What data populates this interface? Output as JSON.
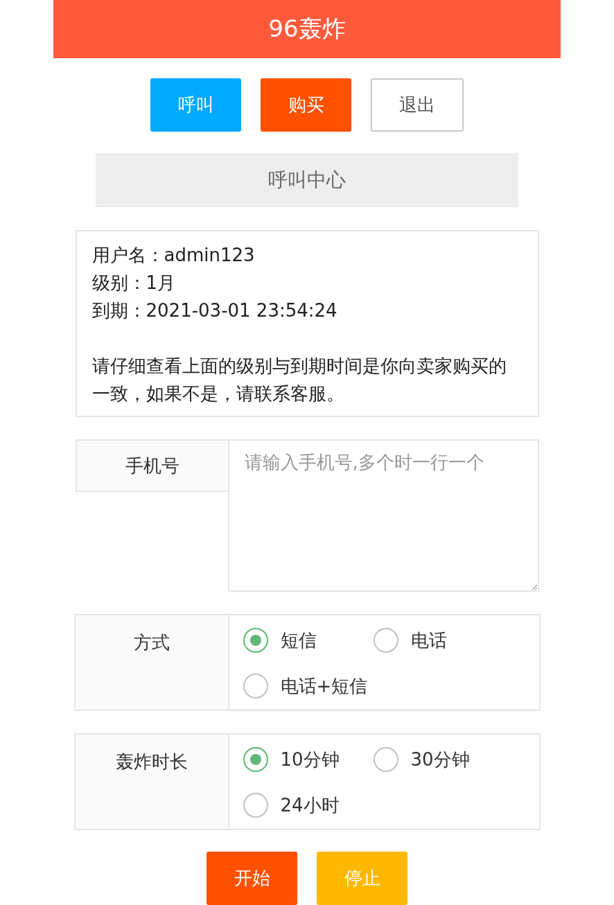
{
  "header": {
    "title": "96轰炸"
  },
  "top_buttons": [
    {
      "label": "呼叫",
      "kind": "primary"
    },
    {
      "label": "购买",
      "kind": "danger"
    },
    {
      "label": "退出",
      "kind": "plain"
    }
  ],
  "section_title": "呼叫中心",
  "info": {
    "lines": [
      "用户名：admin123",
      "级别：1月",
      "到期：2021-03-01 23:54:24"
    ],
    "notice": "请仔细查看上面的级别与到期时间是你向卖家购买的一致，如果不是，请联系客服。"
  },
  "phone": {
    "label": "手机号",
    "placeholder": "请输入手机号,多个时一行一个"
  },
  "groups": [
    {
      "label": "方式",
      "options": [
        {
          "label": "短信",
          "selected": true
        },
        {
          "label": "电话",
          "selected": false
        },
        {
          "label": "电话+短信",
          "selected": false
        }
      ]
    },
    {
      "label": "轰炸时长",
      "options": [
        {
          "label": "10分钟",
          "selected": true
        },
        {
          "label": "30分钟",
          "selected": false
        },
        {
          "label": "24小时",
          "selected": false
        }
      ]
    }
  ],
  "actions": [
    {
      "label": "开始",
      "kind": "danger"
    },
    {
      "label": "停止",
      "kind": "warning"
    }
  ]
}
